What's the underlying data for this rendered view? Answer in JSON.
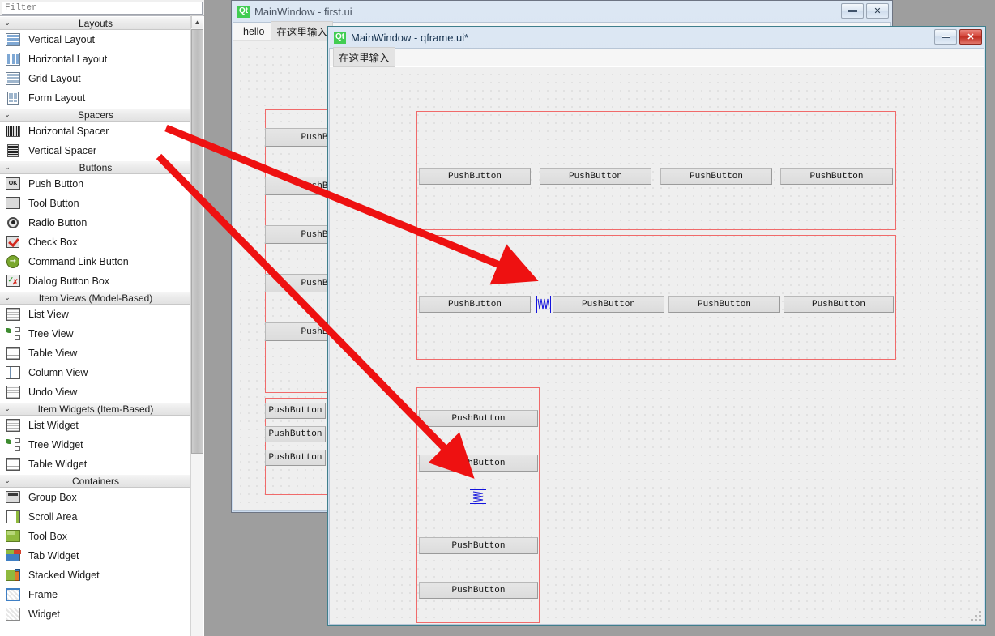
{
  "widget_box": {
    "filter_placeholder": "Filter",
    "categories": [
      {
        "title": "Layouts",
        "chevron": "⌄",
        "items": [
          {
            "label": "Vertical Layout",
            "icon": "vertical-layout-icon"
          },
          {
            "label": "Horizontal Layout",
            "icon": "horizontal-layout-icon"
          },
          {
            "label": "Grid Layout",
            "icon": "grid-layout-icon"
          },
          {
            "label": "Form Layout",
            "icon": "form-layout-icon"
          }
        ]
      },
      {
        "title": "Spacers",
        "chevron": "⌄",
        "items": [
          {
            "label": "Horizontal Spacer",
            "icon": "horizontal-spacer-icon"
          },
          {
            "label": "Vertical Spacer",
            "icon": "vertical-spacer-icon"
          }
        ]
      },
      {
        "title": "Buttons",
        "chevron": "⌄",
        "items": [
          {
            "label": "Push Button",
            "icon": "push-button-icon"
          },
          {
            "label": "Tool Button",
            "icon": "tool-button-icon"
          },
          {
            "label": "Radio Button",
            "icon": "radio-button-icon"
          },
          {
            "label": "Check Box",
            "icon": "check-box-icon"
          },
          {
            "label": "Command Link Button",
            "icon": "command-link-button-icon"
          },
          {
            "label": "Dialog Button Box",
            "icon": "dialog-button-box-icon"
          }
        ]
      },
      {
        "title": "Item Views (Model-Based)",
        "chevron": "⌄",
        "items": [
          {
            "label": "List View",
            "icon": "list-view-icon"
          },
          {
            "label": "Tree View",
            "icon": "tree-view-icon"
          },
          {
            "label": "Table View",
            "icon": "table-view-icon"
          },
          {
            "label": "Column View",
            "icon": "column-view-icon"
          },
          {
            "label": "Undo View",
            "icon": "undo-view-icon"
          }
        ]
      },
      {
        "title": "Item Widgets (Item-Based)",
        "chevron": "⌄",
        "items": [
          {
            "label": "List Widget",
            "icon": "list-widget-icon"
          },
          {
            "label": "Tree Widget",
            "icon": "tree-widget-icon"
          },
          {
            "label": "Table Widget",
            "icon": "table-widget-icon"
          }
        ]
      },
      {
        "title": "Containers",
        "chevron": "⌄",
        "items": [
          {
            "label": "Group Box",
            "icon": "group-box-icon"
          },
          {
            "label": "Scroll Area",
            "icon": "scroll-area-icon"
          },
          {
            "label": "Tool Box",
            "icon": "tool-box-icon"
          },
          {
            "label": "Tab Widget",
            "icon": "tab-widget-icon"
          },
          {
            "label": "Stacked Widget",
            "icon": "stacked-widget-icon"
          },
          {
            "label": "Frame",
            "icon": "frame-icon"
          },
          {
            "label": "Widget",
            "icon": "widget-icon"
          }
        ]
      }
    ]
  },
  "back_window": {
    "title": "MainWindow - first.ui",
    "logo_text": "Qt",
    "menu": {
      "items": [
        "hello"
      ],
      "placeholder": "在这里输入"
    },
    "controls": {
      "minimize": "minimize",
      "close": "✕"
    },
    "buttons_column_top": [
      "PushButton",
      "PushButton",
      "PushButton",
      "PushButton",
      "PushButton"
    ],
    "buttons_column_bottom": [
      "PushButton",
      "PushButton",
      "PushButton"
    ]
  },
  "front_window": {
    "title": "MainWindow - qframe.ui*",
    "logo_text": "Qt",
    "menu": {
      "placeholder": "在这里输入"
    },
    "controls": {
      "minimize": "minimize",
      "close": "✕"
    },
    "group_top": {
      "buttons": [
        "PushButton",
        "PushButton",
        "PushButton",
        "PushButton"
      ]
    },
    "group_middle": {
      "buttons": [
        "PushButton",
        "PushButton",
        "PushButton",
        "PushButton"
      ],
      "spacer": "horizontal-spacer"
    },
    "group_vertical": {
      "buttons": [
        "PushButton",
        "PushButton",
        "PushButton",
        "PushButton"
      ],
      "spacer": "vertical-spacer"
    }
  },
  "annotations": {
    "arrow_color": "#ee1111",
    "arrows": [
      {
        "name": "arrow-to-horizontal-spacer",
        "from": "Horizontal Spacer",
        "to": "horizontal spacer in middle group"
      },
      {
        "name": "arrow-to-vertical-spacer",
        "from": "Vertical Spacer",
        "to": "vertical spacer in vertical group"
      }
    ]
  },
  "colors": {
    "desktop": "#9e9e9e",
    "canvas": "#efefef",
    "red_outline": "#f06a6a",
    "spacer_blue": "#1414dd",
    "qt_green": "#41cd52"
  }
}
